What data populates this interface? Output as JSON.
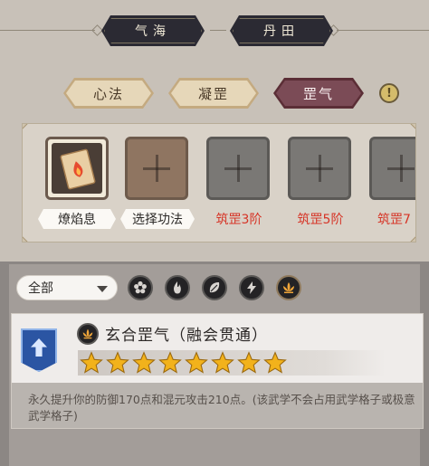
{
  "top_tabs": [
    {
      "label": "气海"
    },
    {
      "label": "丹田"
    }
  ],
  "sub_tabs": [
    {
      "label": "心法",
      "active": false
    },
    {
      "label": "凝罡",
      "active": false
    },
    {
      "label": "罡气",
      "active": true
    }
  ],
  "info_button": {
    "label": "!"
  },
  "slots": [
    {
      "label": "燎焰息",
      "state": "filled"
    },
    {
      "label": "选择功法",
      "state": "select"
    },
    {
      "label": "筑罡3阶",
      "state": "locked"
    },
    {
      "label": "筑罡5阶",
      "state": "locked"
    },
    {
      "label": "筑罡7",
      "state": "locked"
    }
  ],
  "filter": {
    "dropdown_value": "全部",
    "icons": [
      "flower-icon",
      "fire-icon",
      "leaf-icon",
      "lightning-icon",
      "lotus-icon"
    ]
  },
  "detail": {
    "title": "玄合罡气（融会贯通）",
    "stars": 8,
    "description": "永久提升你的防御170点和混元攻击210点。(该武学不会占用武学格子或极意武学格子)"
  },
  "colors": {
    "active_tab": "#7b4b56",
    "star": "#f2b21b",
    "locked_label": "#d63426"
  }
}
